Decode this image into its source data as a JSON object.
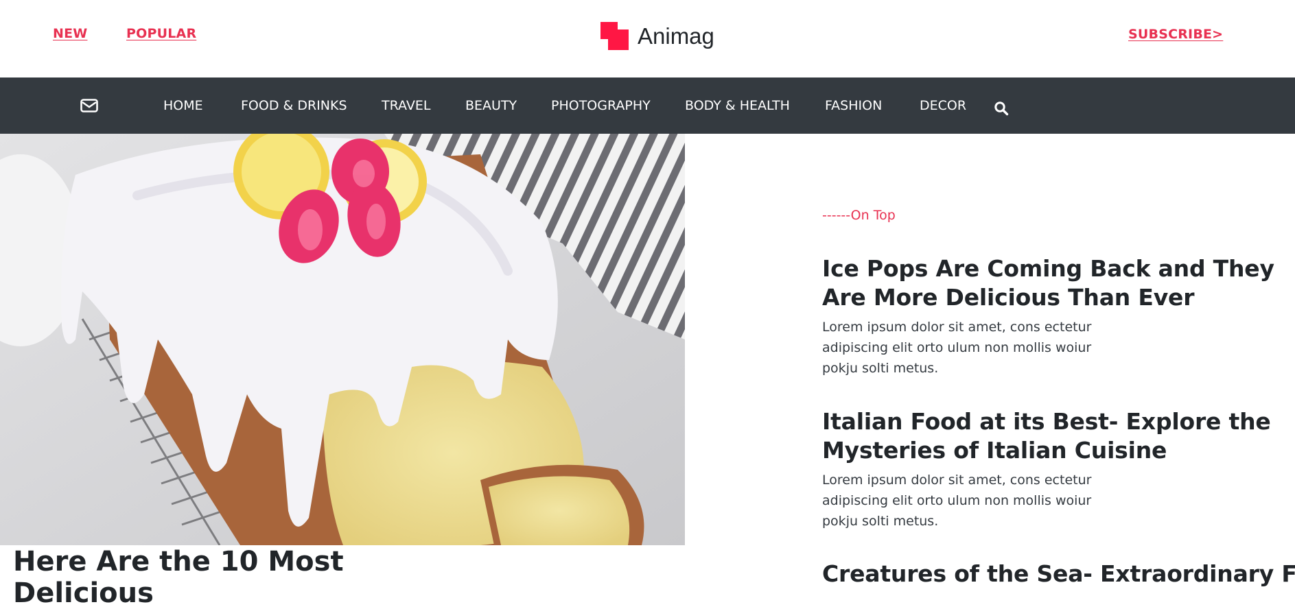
{
  "header": {
    "links": {
      "new": "NEW",
      "popular": "POPULAR",
      "subscribe": "SUBSCRIBE>"
    },
    "brand": "Animag",
    "accent_color": "#e83151"
  },
  "nav": {
    "items": [
      "HOME",
      "FOOD & DRINKS",
      "TRAVEL",
      "BEAUTY",
      "PHOTOGRAPHY",
      "BODY & HEALTH",
      "FASHION",
      "DECOR"
    ],
    "icons": {
      "mail": "envelope-icon",
      "search": "search-icon"
    },
    "background": "#343a40"
  },
  "feature": {
    "image": "glazed-lemon-loaf-cake",
    "title": "Here Are the 10 Most Delicious"
  },
  "sidebar": {
    "section_label": "------On Top",
    "articles": [
      {
        "title": "Ice Pops Are Coming Back and They Are More Delicious Than Ever",
        "excerpt": "Lorem ipsum dolor sit amet, cons ectetur adipiscing elit orto ulum non mollis woiur pokju solti metus."
      },
      {
        "title": "Italian Food at its Best- Explore the Mysteries of Italian Cuisine",
        "excerpt": "Lorem ipsum dolor sit amet, cons ectetur adipiscing elit orto ulum non mollis woiur pokju solti metus."
      },
      {
        "title": "Creatures of the Sea- Extraordinary Food",
        "excerpt": ""
      }
    ]
  }
}
